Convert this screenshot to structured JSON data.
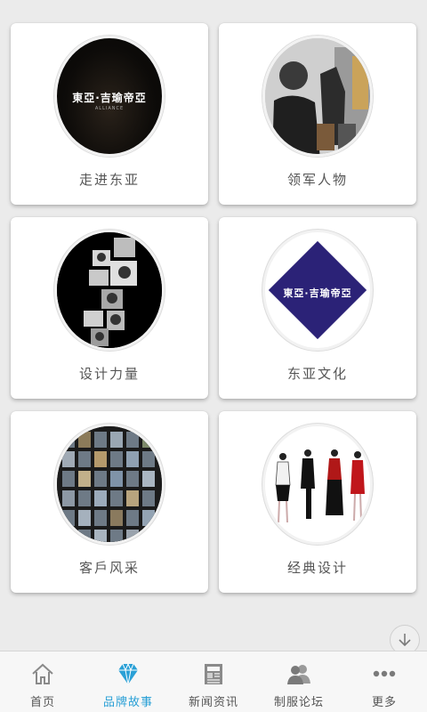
{
  "grid": {
    "items": [
      {
        "label": "走进东亚",
        "image": "东亚·吉瑜帝亚 logo on black"
      },
      {
        "label": "领军人物",
        "image": "portrait photo"
      },
      {
        "label": "设计力量",
        "image": "photo collage"
      },
      {
        "label": "东亚文化",
        "image": "东亚·吉瑜帝亚 blue diamond logo"
      },
      {
        "label": "客戶风采",
        "image": "building photo grid"
      },
      {
        "label": "经典设计",
        "image": "uniform fashion illustrations"
      }
    ]
  },
  "logo": {
    "brand": "東亞·吉瑜帝亞",
    "sub": "ALLIANCE"
  },
  "tabbar": {
    "active_color": "#2aa0d6",
    "tabs": [
      {
        "label": "首页",
        "icon": "home-icon"
      },
      {
        "label": "品牌故事",
        "icon": "diamond-icon",
        "active": true
      },
      {
        "label": "新闻资讯",
        "icon": "newspaper-icon"
      },
      {
        "label": "制服论坛",
        "icon": "users-icon"
      },
      {
        "label": "更多",
        "icon": "more-icon"
      }
    ]
  }
}
